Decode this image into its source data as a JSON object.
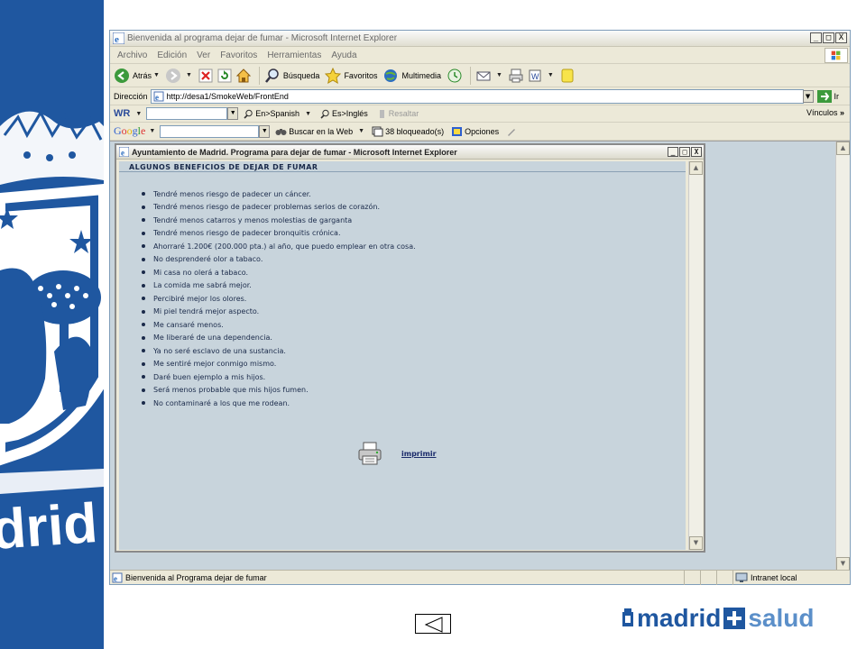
{
  "window": {
    "title": "Bienvenida al programa dejar de fumar - Microsoft Internet Explorer",
    "controls": [
      "_",
      "□",
      "X"
    ]
  },
  "menu": [
    "Archivo",
    "Edición",
    "Ver",
    "Favoritos",
    "Herramientas",
    "Ayuda"
  ],
  "toolbar": {
    "back_label": "Atrás",
    "search_label": "Búsqueda",
    "favorites_label": "Favoritos",
    "multimedia_label": "Multimedia"
  },
  "address": {
    "label": "Dirección",
    "url": "http://desa1/SmokeWeb/FrontEnd",
    "go_label": "Ir"
  },
  "wr_bar": {
    "logo": "WR",
    "en_es": "En>Spanish",
    "es_en": "Es>Inglés",
    "highlight": "Resaltar",
    "links": "Vínculos"
  },
  "google_bar": {
    "logo": "Google",
    "search_web": "Buscar en la Web",
    "blocked": "38 bloqueado(s)",
    "options": "Opciones"
  },
  "popup": {
    "title": "Ayuntamiento de Madrid. Programa para dejar de fumar - Microsoft Internet Explorer",
    "heading": "ALGUNOS BENEFICIOS DE DEJAR DE FUMAR",
    "benefits": [
      "Tendré menos riesgo de padecer un cáncer.",
      "Tendré menos riesgo de padecer problemas serios de corazón.",
      "Tendré menos catarros y menos molestias de garganta",
      "Tendré menos riesgo de padecer bronquitis crónica.",
      "Ahorraré 1.200€ (200.000 pta.) al año, que puedo emplear en otra cosa.",
      "No desprenderé olor a tabaco.",
      "Mi casa no olerá a tabaco.",
      "La comida me sabrá mejor.",
      "Percibiré mejor los olores.",
      "Mi piel tendrá mejor aspecto.",
      "Me cansaré menos.",
      "Me liberaré de una dependencia.",
      "Ya no seré esclavo de una sustancia.",
      "Me sentiré mejor conmigo mismo.",
      "Daré buen ejemplo a mis hijos.",
      "Será menos probable que mis hijos fumen.",
      "No contaminaré a los que me rodean."
    ],
    "print_label": "imprimir"
  },
  "status": {
    "text": "Bienvenida al Programa dejar de fumar",
    "zone": "Intranet local"
  },
  "footer": {
    "logo_madrid": "madrid",
    "logo_salud": "salud"
  },
  "side_text": "drid",
  "colors": {
    "panel_blue": "#1f57a0",
    "content_bg": "#c8d4dc",
    "logo_blue": "#1f57a0",
    "logo_salud": "#5b8fc9"
  }
}
